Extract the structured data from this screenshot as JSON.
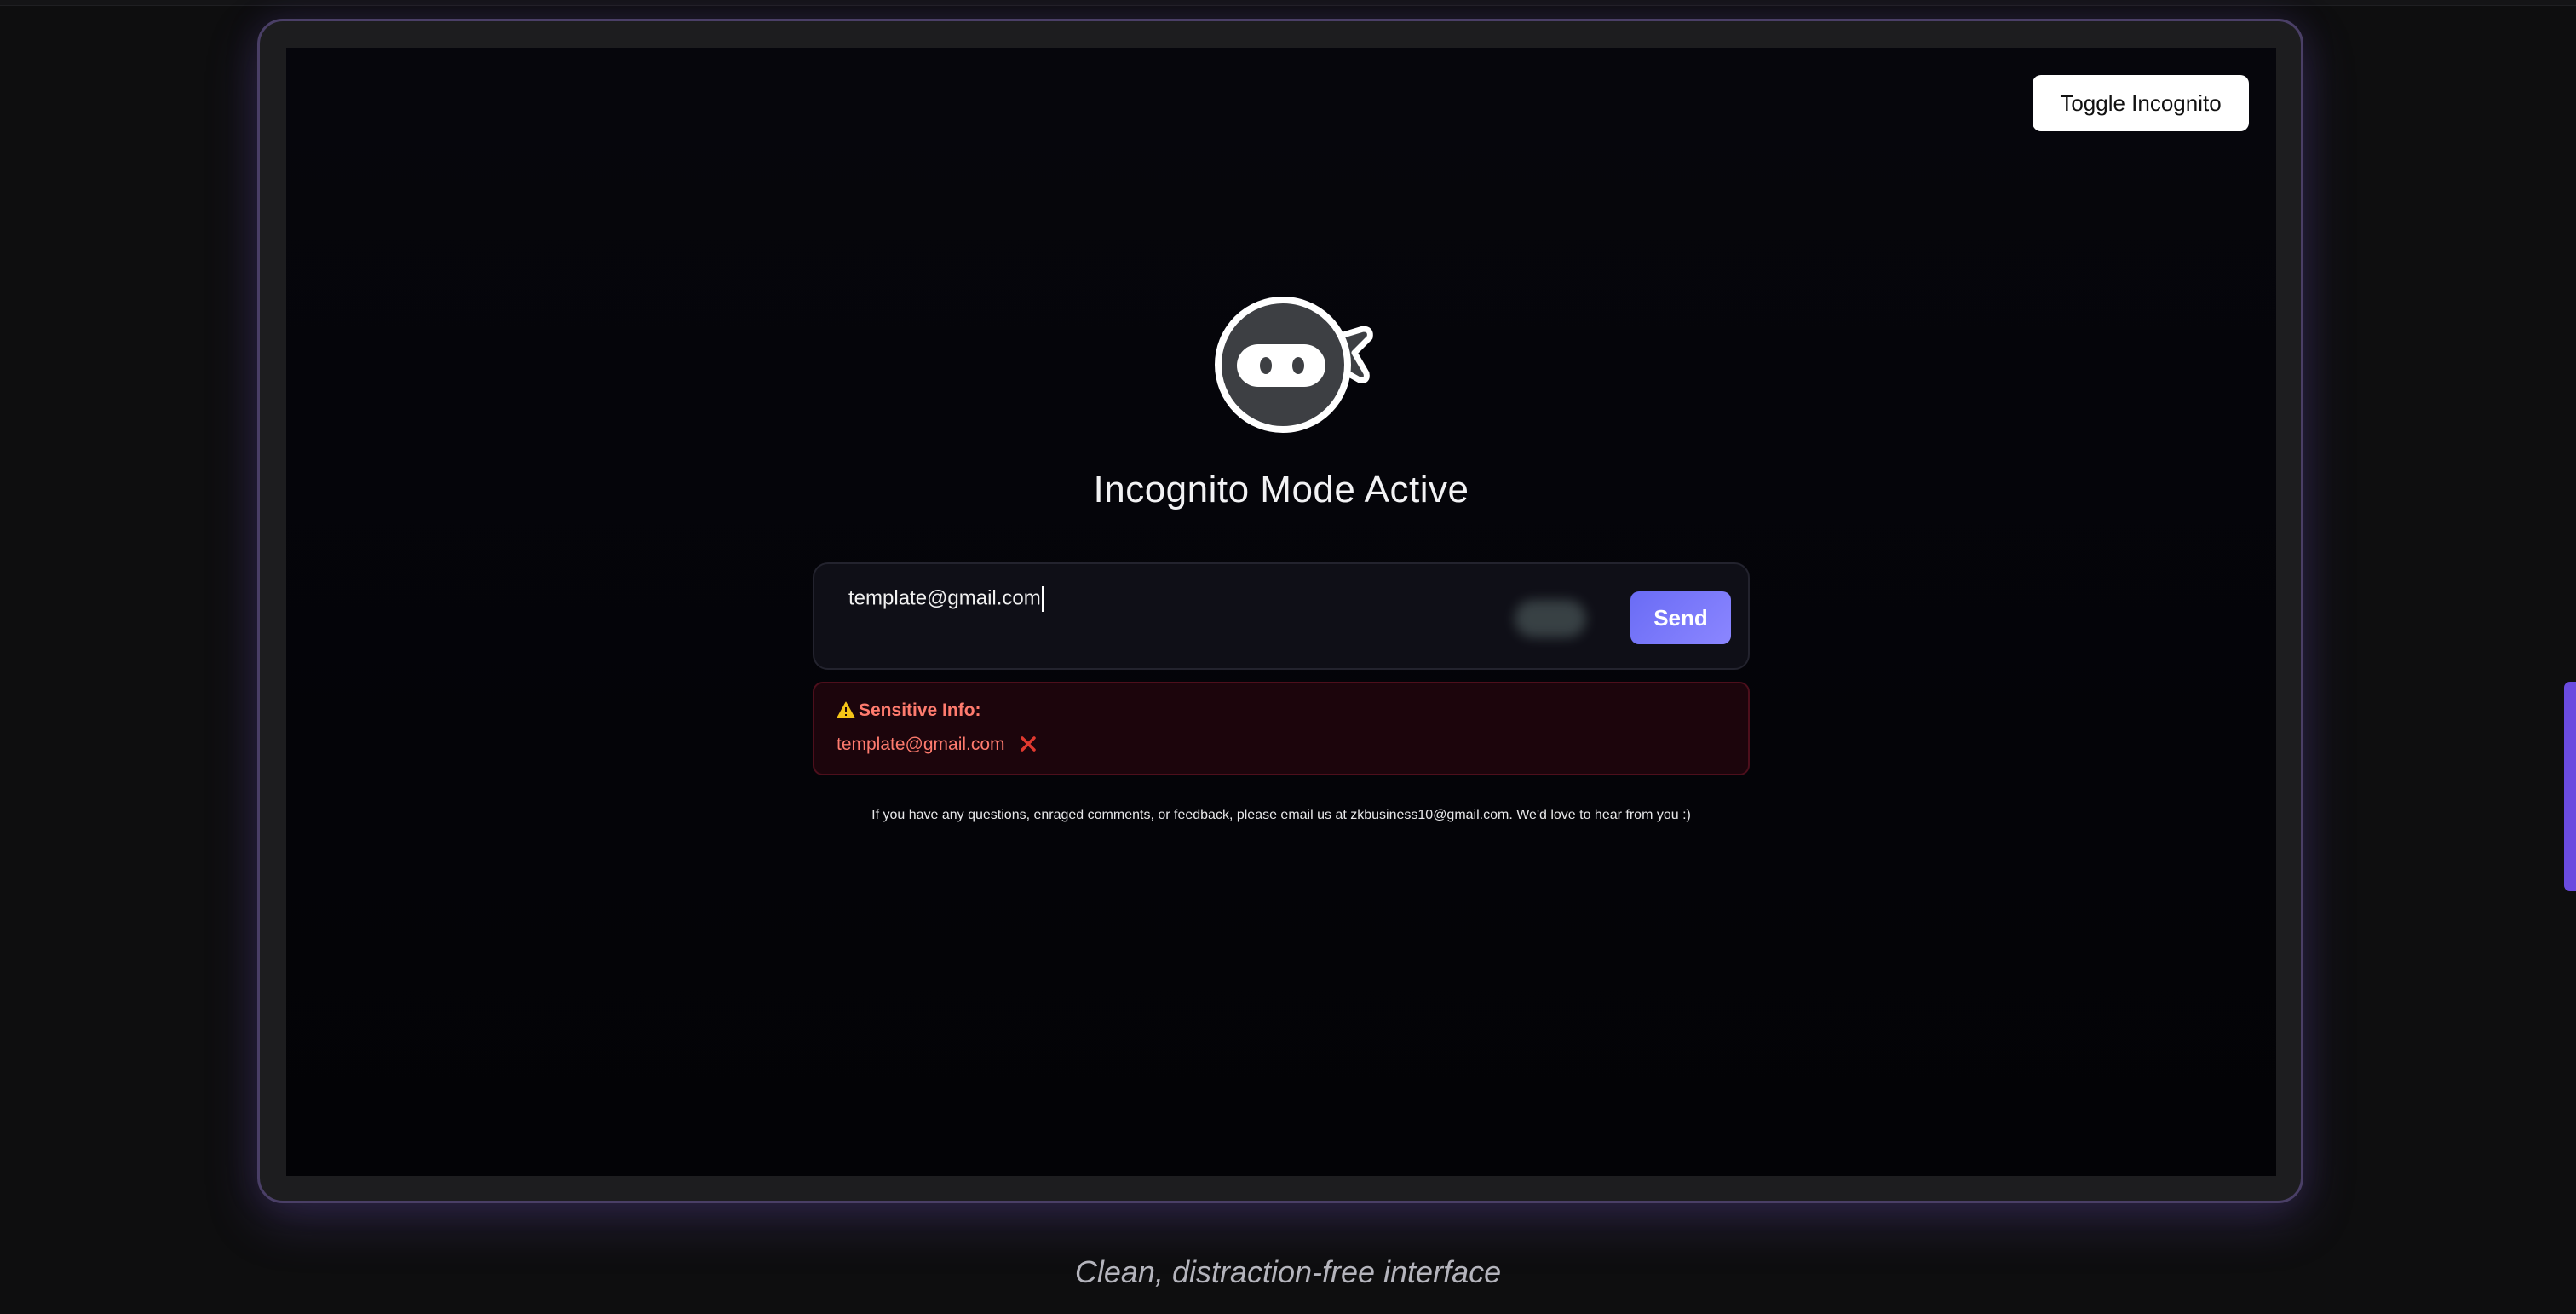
{
  "header": {
    "toggle_label": "Toggle Incognito"
  },
  "main": {
    "logo_icon": "ninja-mask-icon",
    "title": "Incognito Mode Active",
    "input": {
      "value": "template@gmail.com",
      "placeholder": ""
    },
    "send_label": "Send",
    "alert": {
      "icon": "warning-icon",
      "heading": "Sensitive Info:",
      "items": [
        "template@gmail.com"
      ],
      "remove_icon": "close-x-icon"
    },
    "footer_note": "If you have any questions, enraged comments, or feedback, please email us at zkbusiness10@gmail.com. We'd love to hear from you :)"
  },
  "caption": "Clean, distraction-free interface",
  "colors": {
    "accent": "#6a6cf5",
    "alert_text": "#ff7b6e",
    "alert_bg": "#1c050c",
    "frame_border": "#4a3f66",
    "scroll_thumb": "#6a4be0"
  }
}
